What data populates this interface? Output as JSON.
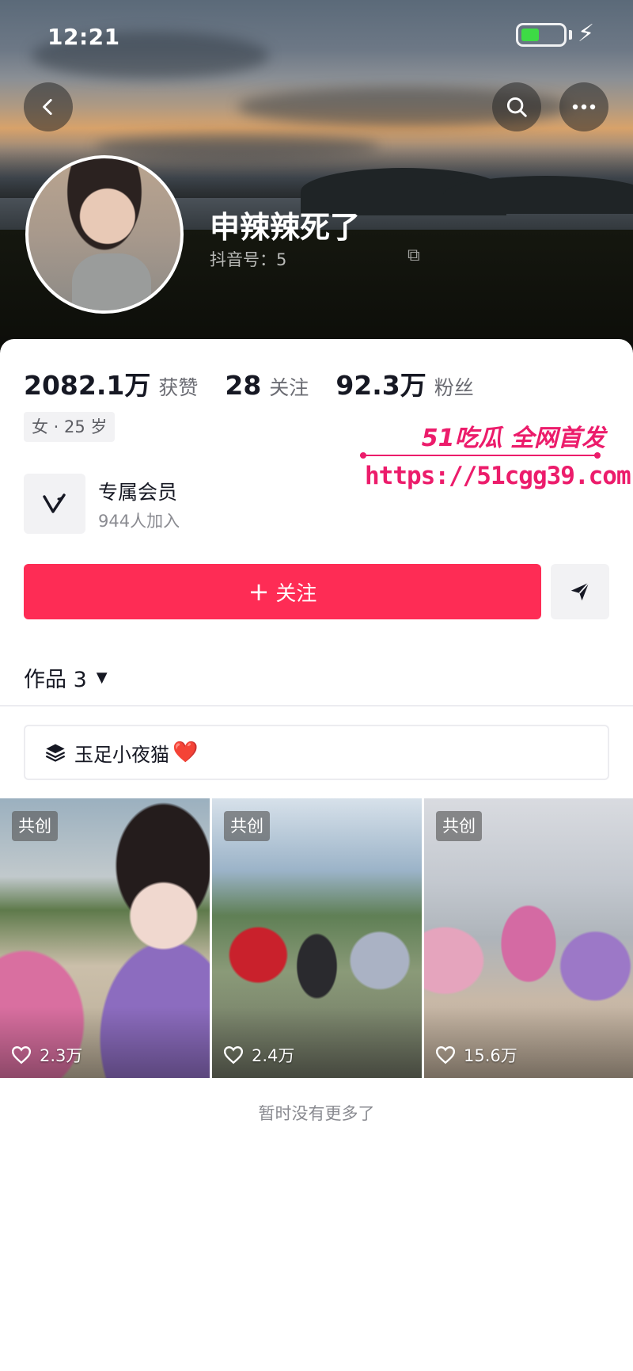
{
  "status_bar": {
    "time": "12:21"
  },
  "colors": {
    "accent": "#fe2c55",
    "battery": "#3ddb45",
    "watermark": "#ec1c6b"
  },
  "header": {
    "back_icon": "chevron-left-icon",
    "search_icon": "search-icon",
    "more_icon": "more-horizontal-icon"
  },
  "profile": {
    "name": "申辣辣死了",
    "id_label": "抖音号：5"
  },
  "stats": [
    {
      "value": "2082.1万",
      "label": "获赞"
    },
    {
      "value": "28",
      "label": "关注"
    },
    {
      "value": "92.3万",
      "label": "粉丝"
    }
  ],
  "tag": "女 · 25 岁",
  "member": {
    "title": "专属会员",
    "subtitle": "944人加入"
  },
  "watermark": {
    "brand": "51吃瓜 全网首发",
    "url": "https://51cgg39.com"
  },
  "actions": {
    "follow": "关注",
    "follow_prefix": "+"
  },
  "works": {
    "tab_label": "作品 3"
  },
  "collection": {
    "label": "玉足小夜猫",
    "emoji": "❤️"
  },
  "videos": [
    {
      "badge": "共创",
      "likes": "2.3万"
    },
    {
      "badge": "共创",
      "likes": "2.4万"
    },
    {
      "badge": "共创",
      "likes": "15.6万"
    }
  ],
  "footer": "暂时没有更多了"
}
